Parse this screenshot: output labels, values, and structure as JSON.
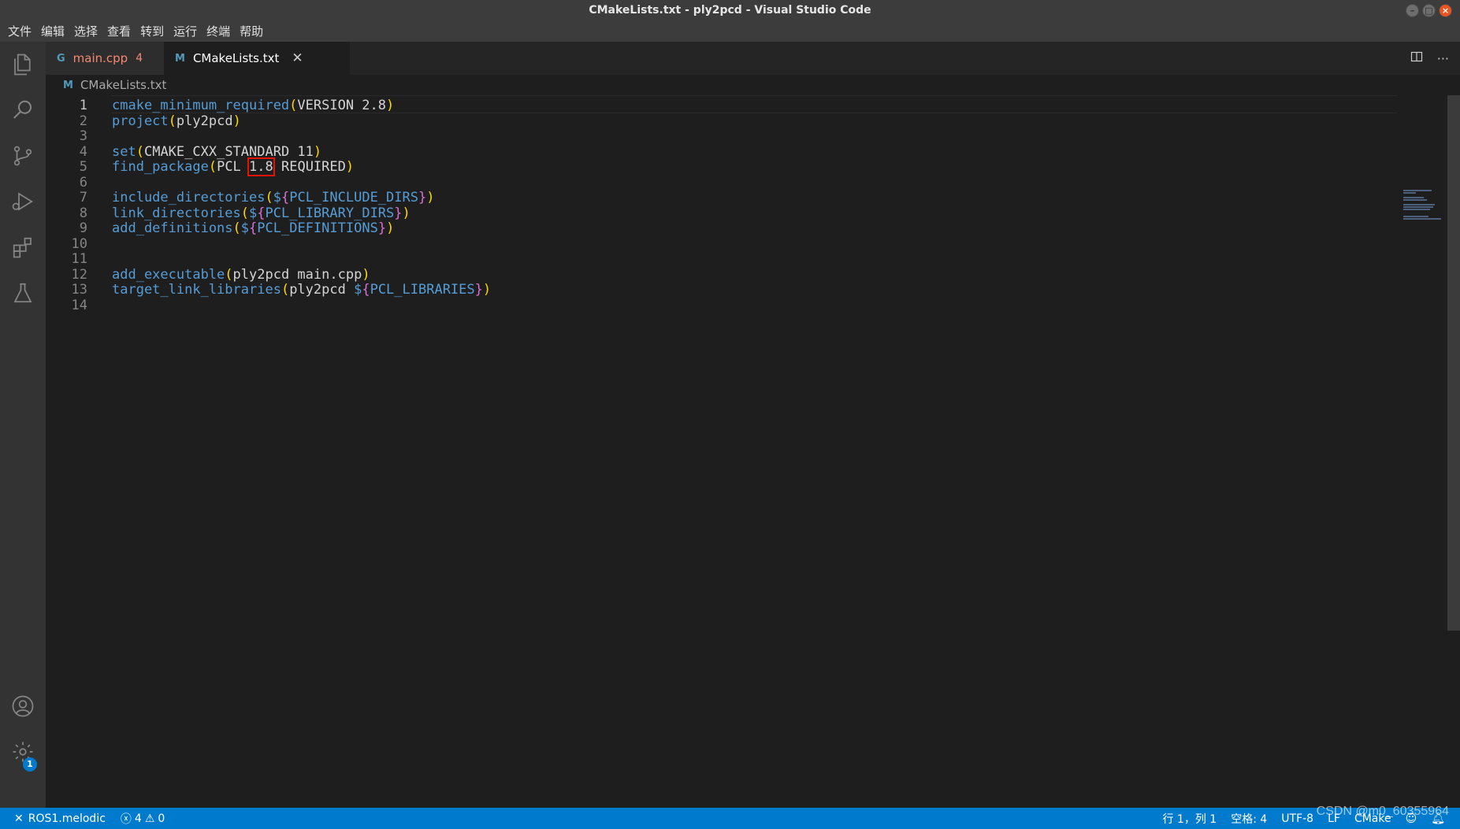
{
  "window": {
    "title": "CMakeLists.txt - ply2pcd - Visual Studio Code"
  },
  "menu": [
    "文件",
    "编辑",
    "选择",
    "查看",
    "转到",
    "运行",
    "终端",
    "帮助"
  ],
  "activity_bar": {
    "items": [
      "explorer-icon",
      "search-icon",
      "source-control-icon",
      "run-debug-icon",
      "extensions-icon",
      "testing-icon"
    ],
    "bottom": [
      "account-icon",
      "settings-gear-icon"
    ],
    "settings_badge": "1"
  },
  "tabs": [
    {
      "icon": "G",
      "label": "main.cpp",
      "problems": "4",
      "active": false
    },
    {
      "icon": "M",
      "label": "CMakeLists.txt",
      "close": "✕",
      "active": true
    }
  ],
  "tab_actions": {
    "split": "split-editor-icon",
    "more": "···"
  },
  "breadcrumb": {
    "icon": "M",
    "file": "CMakeLists.txt"
  },
  "editor": {
    "lines": [
      {
        "n": "1",
        "text": "cmake_minimum_required(VERSION 2.8)"
      },
      {
        "n": "2",
        "text": "project(ply2pcd)"
      },
      {
        "n": "3",
        "text": ""
      },
      {
        "n": "4",
        "text": "set(CMAKE_CXX_STANDARD 11)"
      },
      {
        "n": "5",
        "text": "find_package(PCL 1.8 REQUIRED)"
      },
      {
        "n": "6",
        "text": ""
      },
      {
        "n": "7",
        "text": "include_directories(${PCL_INCLUDE_DIRS})"
      },
      {
        "n": "8",
        "text": "link_directories(${PCL_LIBRARY_DIRS})"
      },
      {
        "n": "9",
        "text": "add_definitions(${PCL_DEFINITIONS})"
      },
      {
        "n": "10",
        "text": ""
      },
      {
        "n": "11",
        "text": ""
      },
      {
        "n": "12",
        "text": "add_executable(ply2pcd main.cpp)"
      },
      {
        "n": "13",
        "text": "target_link_libraries(ply2pcd ${PCL_LIBRARIES})"
      },
      {
        "n": "14",
        "text": ""
      }
    ],
    "highlighted_token": "1.8",
    "highlight_color": "#e51400"
  },
  "status": {
    "remote": "ROS1.melodic",
    "errors": "4",
    "warnings": "0",
    "position": "行 1，列 1",
    "indent": "空格: 4",
    "encoding": "UTF-8",
    "eol": "LF",
    "language": "CMake"
  },
  "watermark": "CSDN @m0_60355964",
  "colors": {
    "accent": "#007acc",
    "function": "#569cd6",
    "bracket1": "#ffd700",
    "bracket2": "#da70d6",
    "variable": "#4ec9b0",
    "error_tab": "#f48771"
  }
}
